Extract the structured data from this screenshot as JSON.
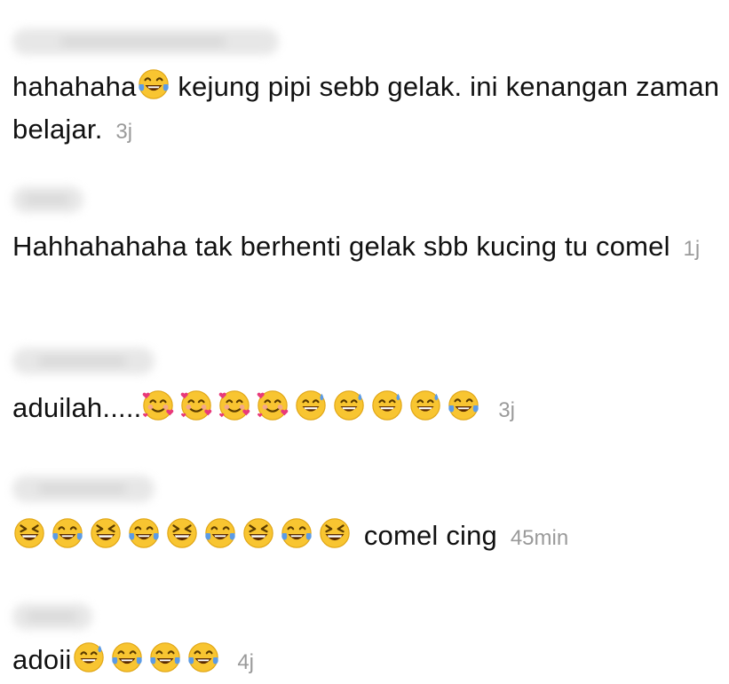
{
  "comments": [
    {
      "text_before": "hahahaha",
      "emojis_inline": [
        "face-with-tears-of-joy-icon"
      ],
      "text_after": " kejung pipi sebb gelak. ini kenangan zaman belajar.",
      "time": "3j"
    },
    {
      "text": "Hahhahahaha tak berhenti gelak sbb kucing tu comel",
      "time": "1j"
    },
    {
      "text": "aduilah.....",
      "emojis": [
        "smiling-face-with-hearts-icon",
        "smiling-face-with-hearts-icon",
        "smiling-face-with-hearts-icon",
        "smiling-face-with-hearts-icon",
        "grinning-face-with-sweat-icon",
        "grinning-face-with-sweat-icon",
        "grinning-face-with-sweat-icon",
        "grinning-face-with-sweat-icon",
        "face-with-tears-of-joy-icon"
      ],
      "time": "3j"
    },
    {
      "emojis": [
        "grinning-squinting-face-icon",
        "face-with-tears-of-joy-icon",
        "grinning-squinting-face-icon",
        "face-with-tears-of-joy-icon",
        "grinning-squinting-face-icon",
        "face-with-tears-of-joy-icon",
        "grinning-squinting-face-icon",
        "face-with-tears-of-joy-icon",
        "grinning-squinting-face-icon"
      ],
      "text": " comel cing",
      "time": "45min"
    },
    {
      "text": "adoii",
      "emojis": [
        "grinning-face-with-sweat-icon",
        "face-with-tears-of-joy-icon",
        "face-with-tears-of-joy-icon",
        "face-with-tears-of-joy-icon"
      ],
      "time": "4j"
    }
  ],
  "colors": {
    "text": "#111111",
    "timestamp": "#9a9a9a",
    "emoji_face": "#f8c531",
    "emoji_tear": "#5b9be6",
    "emoji_heart": "#e8397a"
  }
}
